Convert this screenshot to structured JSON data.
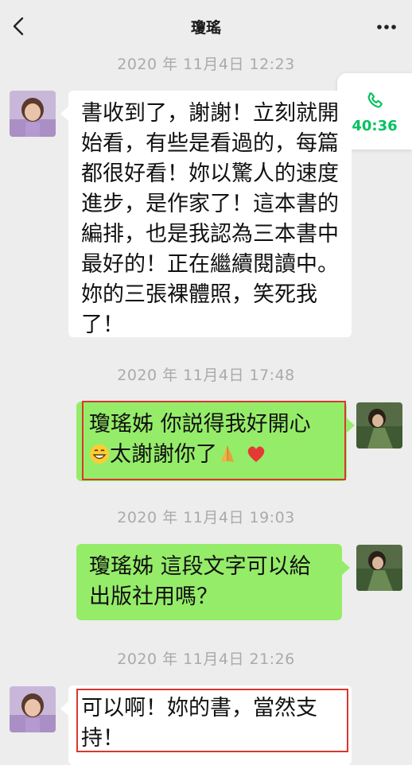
{
  "header": {
    "title": "瓊瑤"
  },
  "call_float": {
    "duration": "40:36",
    "icon": "phone-icon",
    "color": "#07c160"
  },
  "messages": [
    {
      "timestamp": "2020 年 11月4日 12:23",
      "side": "left",
      "text": "書收到了，謝謝！立刻就開始看，有些是看過的，每篇都很好看！妳以驚人的速度進步，是作家了！這本書的編排，也是我認為三本書中最好的！正在繼續閱讀中。妳的三張裸體照，笑死我了！"
    },
    {
      "timestamp": "2020 年 11月4日 17:48",
      "side": "right",
      "text_line1": "瓊瑤姊 你説得我好開心",
      "text_line2": "太謝謝你了",
      "emojis": [
        "grinning-face-icon",
        "folded-hands-icon",
        "red-heart-icon"
      ],
      "highlighted": true
    },
    {
      "timestamp": "2020 年 11月4日 19:03",
      "side": "right",
      "text": "瓊瑤姊 這段文字可以給出版社用嗎？"
    },
    {
      "timestamp": "2020 年 11月4日 21:26",
      "side": "left",
      "text": "可以啊！妳的書，當然支持！",
      "highlighted": true
    }
  ],
  "colors": {
    "background": "#ededed",
    "bubble_self": "#95ec69",
    "bubble_other": "#ffffff",
    "highlight_box": "#d9372f",
    "timestamp": "#aaaaaa"
  }
}
